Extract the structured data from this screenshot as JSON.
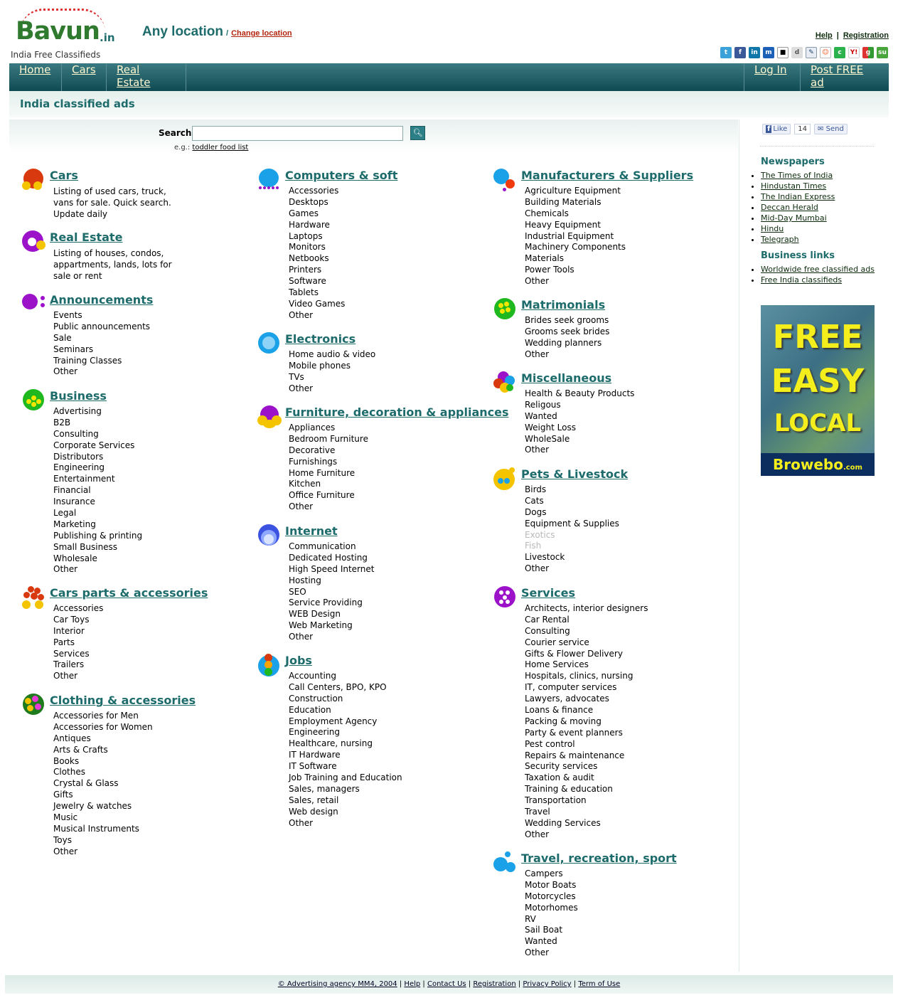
{
  "header": {
    "logo_text": "Bavun",
    "logo_tld": ".in",
    "tagline": "India Free Classifieds",
    "location": "Any location",
    "location_sep": "/",
    "change_location": "Change location",
    "help": "Help",
    "registration": "Registration",
    "bar": "|"
  },
  "social_icons": [
    "twitter-icon",
    "facebook-icon",
    "linkedin-icon",
    "myspace-icon",
    "delicious-icon",
    "digg-icon",
    "blogger-icon",
    "reddit-icon",
    "technorati-icon",
    "yahoo-icon",
    "google-icon",
    "stumbleupon-icon"
  ],
  "nav": {
    "home": "Home",
    "cars": "Cars",
    "real_estate": "Real Estate",
    "login": "Log In",
    "post_ad": "Post FREE ad"
  },
  "page_title": "India classified ads",
  "search": {
    "label": "Search",
    "value": "",
    "eg_label": "e.g.:",
    "eg_link": "toddler food list"
  },
  "categories": {
    "cars": {
      "title": "Cars",
      "desc": "Listing of used cars, truck, vans for sale. Quick search. Update daily"
    },
    "real_estate": {
      "title": "Real Estate",
      "desc": "Listing of houses, condos, appartments, lands, lots for sale or rent"
    },
    "announcements": {
      "title": "Announcements",
      "items": [
        "Events",
        "Public announcements",
        "Sale",
        "Seminars",
        "Training Classes",
        "Other"
      ]
    },
    "business": {
      "title": "Business",
      "items": [
        "Advertising",
        "B2B",
        "Consulting",
        "Corporate Services",
        "Distributors",
        "Engineering",
        "Entertainment",
        "Financial",
        "Insurance",
        "Legal",
        "Marketing",
        "Publishing & printing",
        "Small Business",
        "Wholesale",
        "Other"
      ]
    },
    "cars_parts": {
      "title": "Cars parts & accessories",
      "items": [
        "Accessories",
        "Car Toys",
        "Interior",
        "Parts",
        "Services",
        "Trailers",
        "Other"
      ]
    },
    "clothing": {
      "title": "Clothing & accessories",
      "items": [
        "Accessories for Men",
        "Accessories for Women",
        "Antiques",
        "Arts & Crafts",
        "Books",
        "Clothes",
        "Crystal & Glass",
        "Gifts",
        "Jewelry & watches",
        "Music",
        "Musical Instruments",
        "Toys",
        "Other"
      ]
    },
    "computers": {
      "title": "Computers & soft",
      "items": [
        "Accessories",
        "Desktops",
        "Games",
        "Hardware",
        "Laptops",
        "Monitors",
        "Netbooks",
        "Printers",
        "Software",
        "Tablets",
        "Video Games",
        "Other"
      ]
    },
    "electronics": {
      "title": "Electronics",
      "items": [
        "Home audio & video",
        "Mobile phones",
        "TVs",
        "Other"
      ]
    },
    "furniture": {
      "title": "Furniture, decoration & appliances",
      "items": [
        "Appliances",
        "Bedroom Furniture",
        "Decorative",
        "Furnishings",
        "Home Furniture",
        "Kitchen",
        "Office Furniture",
        "Other"
      ]
    },
    "internet": {
      "title": "Internet",
      "items": [
        "Communication",
        "Dedicated Hosting",
        "High Speed Internet",
        "Hosting",
        "SEO",
        "Service Providing",
        "WEB Design",
        "Web Marketing",
        "Other"
      ]
    },
    "jobs": {
      "title": "Jobs",
      "items": [
        "Accounting",
        "Call Centers, BPO, KPO",
        "Construction",
        "Education",
        "Employment Agency",
        "Engineering",
        "Healthcare, nursing",
        "IT Hardware",
        "IT Software",
        "Job Training and Education",
        "Sales, managers",
        "Sales, retail",
        "Web design",
        "Other"
      ]
    },
    "manufacturers": {
      "title": "Manufacturers & Suppliers",
      "items": [
        "Agriculture Equipment",
        "Building Materials",
        "Chemicals",
        "Heavy Equipment",
        "Industrial Equipment",
        "Machinery Components",
        "Materials",
        "Power Tools",
        "Other"
      ]
    },
    "matrimonials": {
      "title": "Matrimonials",
      "items": [
        "Brides seek grooms",
        "Grooms seek brides",
        "Wedding planners",
        "Other"
      ]
    },
    "misc": {
      "title": "Miscellaneous",
      "items": [
        "Health & Beauty Products",
        "Religous",
        "Wanted",
        "Weight Loss",
        "WholeSale",
        "Other"
      ]
    },
    "pets": {
      "title": "Pets & Livestock",
      "items": [
        "Birds",
        "Cats",
        "Dogs",
        "Equipment & Supplies",
        "Exotics",
        "Fish",
        "Livestock",
        "Other"
      ]
    },
    "services": {
      "title": "Services",
      "items": [
        "Architects, interior designers",
        "Car Rental",
        "Consulting",
        "Courier service",
        "Gifts & Flower Delivery",
        "Home Services",
        "Hospitals, clinics, nursing",
        "IT, computer services",
        "Lawyers, advocates",
        "Loans & finance",
        "Packing & moving",
        "Party & event planners",
        "Pest control",
        "Repairs & maintenance",
        "Security services",
        "Taxation & audit",
        "Training & education",
        "Transportation",
        "Travel",
        "Wedding Services",
        "Other"
      ]
    },
    "travel": {
      "title": "Travel, recreation, sport",
      "items": [
        "Campers",
        "Motor Boats",
        "Motorcycles",
        "Motorhomes",
        "RV",
        "Sail Boat",
        "Wanted",
        "Other"
      ]
    }
  },
  "sidebar": {
    "fb_like": "Like",
    "fb_count": "14",
    "fb_send": "Send",
    "newspapers_title": "Newspapers",
    "newspapers": [
      "The Times of India",
      "Hindustan Times",
      "The Indian Express",
      "Deccan Herald",
      "Mid-Day Mumbai",
      "Hindu",
      "Telegraph"
    ],
    "business_title": "Business links",
    "business_links": [
      "Worldwide free classified ads",
      "Free India classifieds"
    ],
    "banner": {
      "line1": "FREE",
      "line2": "EASY",
      "line3": "LOCAL",
      "brand": "Browebo",
      "brand_tld": ".com"
    }
  },
  "footer": {
    "copyright": "© Advertising agency MM4, 2004",
    "help": "Help",
    "contact": "Contact Us",
    "registration": "Registration",
    "privacy": "Privacy Policy",
    "terms": "Term of Use",
    "sep": "|"
  },
  "colors": {
    "accent": "#1d6b6b",
    "nav_bg": "#0f4a52",
    "nav_text": "#fff7d0",
    "banner_text": "#f4ee1c"
  }
}
